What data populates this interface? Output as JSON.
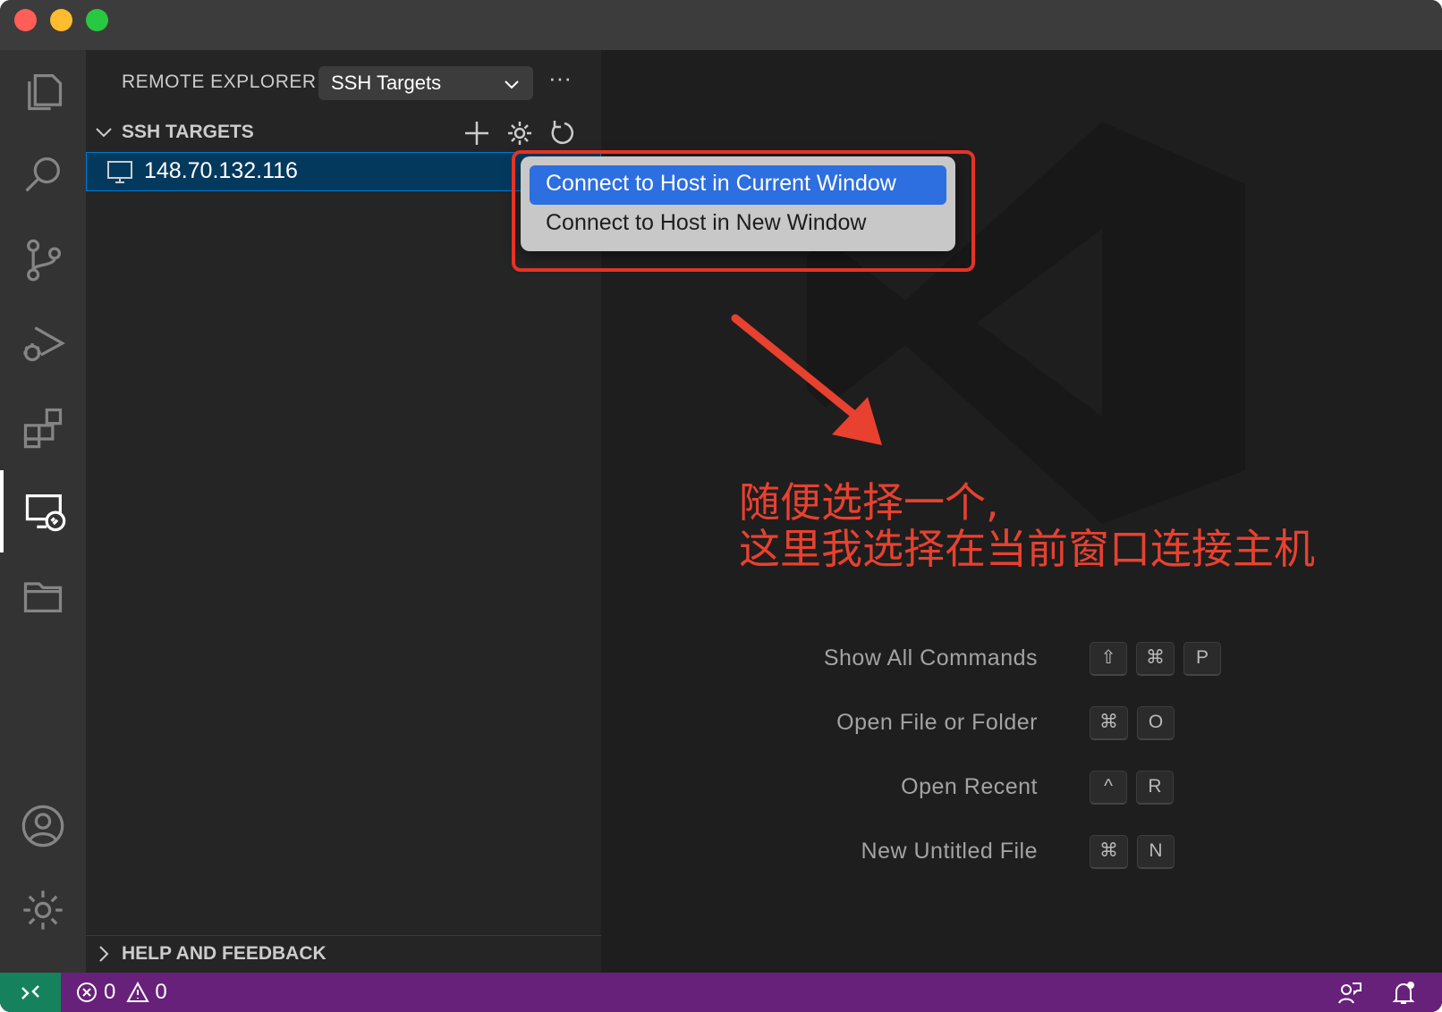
{
  "sidebar": {
    "title": "REMOTE EXPLORER",
    "select_value": "SSH Targets",
    "more_label": "···",
    "section_title": "SSH TARGETS",
    "hosts": [
      {
        "label": "148.70.132.116"
      }
    ],
    "help_title": "HELP AND FEEDBACK"
  },
  "context_menu": {
    "items": [
      {
        "label": "Connect to Host in Current Window",
        "selected": true
      },
      {
        "label": "Connect to Host in New Window",
        "selected": false
      }
    ]
  },
  "annotation": {
    "line1": "随便选择一个,",
    "line2": "这里我选择在当前窗口连接主机",
    "color": "#e8412f"
  },
  "editor": {
    "shortcuts": [
      {
        "label": "Show All Commands",
        "keys": [
          "⇧",
          "⌘",
          "P"
        ]
      },
      {
        "label": "Open File or Folder",
        "keys": [
          "⌘",
          "O"
        ]
      },
      {
        "label": "Open Recent",
        "keys": [
          "^",
          "R"
        ]
      },
      {
        "label": "New Untitled File",
        "keys": [
          "⌘",
          "N"
        ]
      }
    ]
  },
  "statusbar": {
    "errors": "0",
    "warnings": "0",
    "bg_color": "#68217a",
    "remote_color": "#16825d"
  },
  "activity_icons": [
    "explorer-icon",
    "search-icon",
    "source-control-icon",
    "run-debug-icon",
    "extensions-icon",
    "remote-explorer-icon",
    "folder-icon",
    "account-icon",
    "settings-gear-icon"
  ]
}
